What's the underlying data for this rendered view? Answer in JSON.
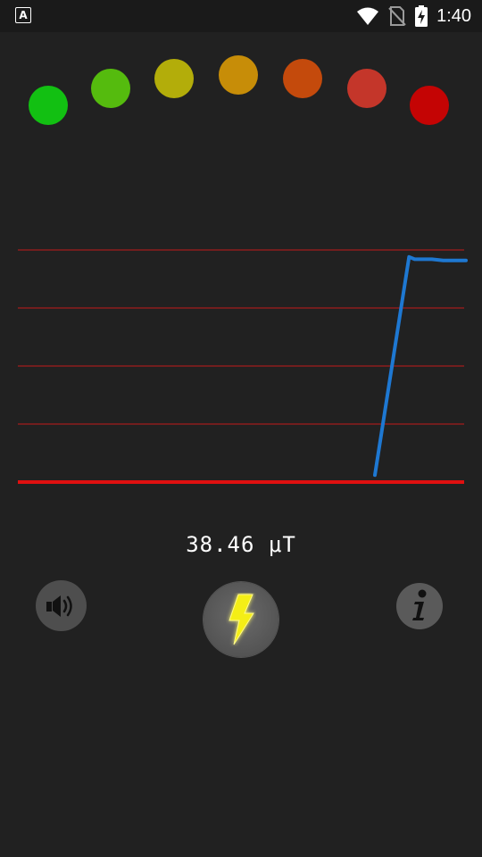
{
  "status_bar": {
    "app_icon_letter": "A",
    "time": "1:40",
    "icons": [
      "wifi-icon",
      "no-sim-icon",
      "battery-charging-icon"
    ]
  },
  "level_indicator": {
    "colors": [
      "#12c012",
      "#55bb0e",
      "#b3ad0a",
      "#c78d08",
      "#c44a0c",
      "#c4362a",
      "#c40404"
    ]
  },
  "graph": {
    "baseline_color": "#e01010",
    "gridline_color": "#c41a1a",
    "series_color": "#1e78d2",
    "series": {
      "x": [
        0,
        0.54,
        0.6,
        0.61,
        0.62,
        0.64,
        0.66,
        0.68,
        0.7
      ],
      "y": [
        0.03,
        0.03,
        0.97,
        0.96,
        0.96,
        0.96,
        0.955,
        0.955,
        0.955
      ]
    }
  },
  "reading": {
    "value": "38.46 μT"
  },
  "buttons": {
    "sound": "speaker-icon",
    "power": "lightning-icon",
    "info": "info-icon"
  }
}
